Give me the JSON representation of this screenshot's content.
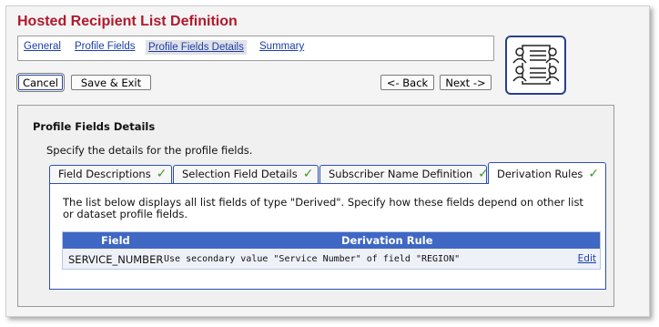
{
  "page": {
    "title": "Hosted Recipient List Definition"
  },
  "nav": {
    "items": [
      {
        "label": "General",
        "selected": false
      },
      {
        "label": "Profile Fields",
        "selected": false
      },
      {
        "label": "Profile Fields Details",
        "selected": true
      },
      {
        "label": "Summary",
        "selected": false
      }
    ]
  },
  "logo": {
    "icon": "recipient-list-icon"
  },
  "buttons": {
    "cancel": "Cancel",
    "save_exit": "Save & Exit",
    "back": "<- Back",
    "next": "Next ->"
  },
  "panel": {
    "heading": "Profile Fields Details",
    "description": "Specify the details for the profile fields."
  },
  "tabs": [
    {
      "label": "Field Descriptions",
      "checked": true
    },
    {
      "label": "Selection Field Details",
      "checked": true
    },
    {
      "label": "Subscriber Name Definition",
      "checked": true
    },
    {
      "label": "Derivation Rules",
      "checked": true,
      "active": true
    }
  ],
  "tab_content": {
    "description": "The list below displays all list fields of type \"Derived\". Specify how these fields depend on other list or dataset profile fields.",
    "table": {
      "columns": [
        "Field",
        "Derivation Rule"
      ],
      "rows": [
        {
          "field": "SERVICE_NUMBER",
          "rule": "Use secondary value \"Service Number\" of field \"REGION\"",
          "action": "Edit"
        }
      ]
    }
  },
  "colors": {
    "title": "#b0192e",
    "link": "#1a3fa8",
    "table_header": "#3f67c4",
    "tab_border": "#2b4fb5",
    "check": "#3a9a2a"
  }
}
